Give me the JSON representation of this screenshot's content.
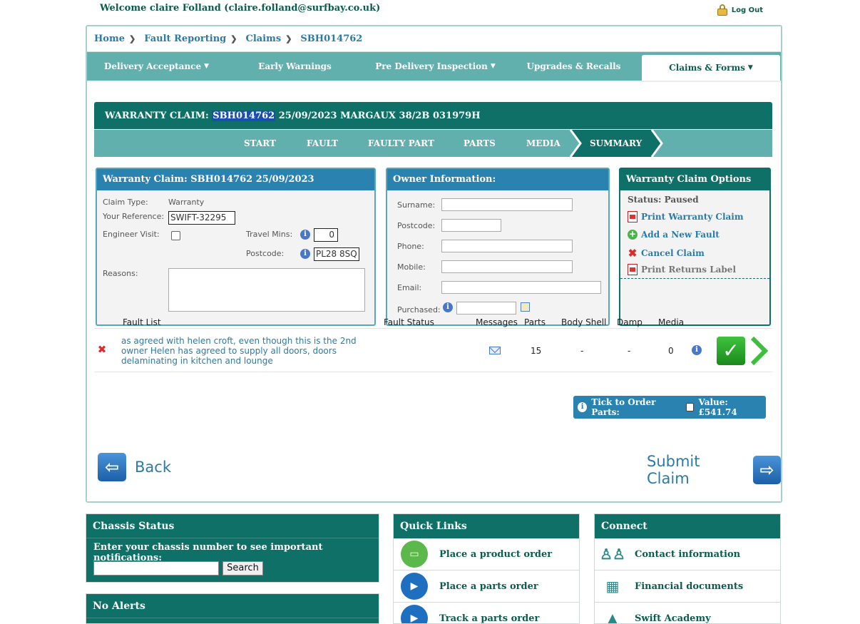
{
  "topbar": {
    "welcome": "Welcome claire Folland (claire.folland@surfbay.co.uk)",
    "logout": "Log Out"
  },
  "breadcrumb": [
    "Home",
    "Fault Reporting",
    "Claims",
    "SBH014762"
  ],
  "nav": {
    "items": [
      {
        "label": "Delivery Acceptance",
        "caret": true
      },
      {
        "label": "Early Warnings",
        "caret": false
      },
      {
        "label": "Pre Delivery Inspection",
        "caret": true
      },
      {
        "label": "Upgrades & Recalls",
        "caret": false
      },
      {
        "label": "Claims & Forms",
        "caret": true,
        "active": true
      }
    ]
  },
  "claim": {
    "header_prefix": "WARRANTY CLAIM: ",
    "claim_no": "SBH014762",
    "header_rest": " 25/09/2023 MARGAUX 38/2B 031979H"
  },
  "steps": [
    "START",
    "FAULT",
    "FAULTY PART",
    "PARTS",
    "MEDIA",
    "SUMMARY"
  ],
  "warranty_box": {
    "title": "Warranty Claim: SBH014762 25/09/2023",
    "claim_type_label": "Claim Type:",
    "claim_type_value": "Warranty",
    "reference_label": "Your Reference:",
    "reference_value": "SWIFT-32295",
    "engineer_label": "Engineer Visit:",
    "travel_label": "Travel Mins:",
    "travel_value": "0",
    "postcode_label": "Postcode:",
    "postcode_value": "PL28 8SQ",
    "reasons_label": "Reasons:"
  },
  "owner_box": {
    "title": "Owner Information:",
    "surname": "Surname:",
    "postcode": "Postcode:",
    "phone": "Phone:",
    "mobile": "Mobile:",
    "email": "Email:",
    "purchased": "Purchased:"
  },
  "options_box": {
    "title": "Warranty Claim Options",
    "status": "Status: Paused",
    "print": "Print Warranty Claim",
    "add_fault": "Add a New Fault",
    "cancel": "Cancel Claim",
    "print_label": "Print Returns Label"
  },
  "fault_list": {
    "headers": {
      "fault": "Fault List",
      "status": "Fault Status",
      "messages": "Messages",
      "parts": "Parts",
      "body_shell": "Body Shell",
      "damp": "Damp",
      "media": "Media"
    },
    "row": {
      "description": "as agreed with helen croft, even though this is the 2nd owner Helen has agreed to supply all doors, doors delaminating in kitchen and lounge",
      "status": "",
      "parts": "15",
      "body_shell": "-",
      "damp": "-",
      "media": "0"
    }
  },
  "order": {
    "tick_label": "Tick to Order Parts:",
    "value_label": "Value: £541.74"
  },
  "buttons": {
    "back": "Back",
    "submit": "Submit Claim"
  },
  "chassis": {
    "title": "Chassis Status",
    "prompt": "Enter your chassis number to see important notifications:",
    "search": "Search"
  },
  "alerts": {
    "title": "No Alerts"
  },
  "quick_links": {
    "title": "Quick Links",
    "items": [
      "Place a product order",
      "Place a parts order",
      "Track a parts order"
    ]
  },
  "connect": {
    "title": "Connect",
    "items": [
      "Contact information",
      "Financial documents",
      "Swift Academy"
    ]
  },
  "colors": {
    "brand_dark": "#0e7066",
    "nav_teal": "#62b0ad",
    "link_blue": "#2a7ba7",
    "box_blue": "#2a82b0"
  }
}
